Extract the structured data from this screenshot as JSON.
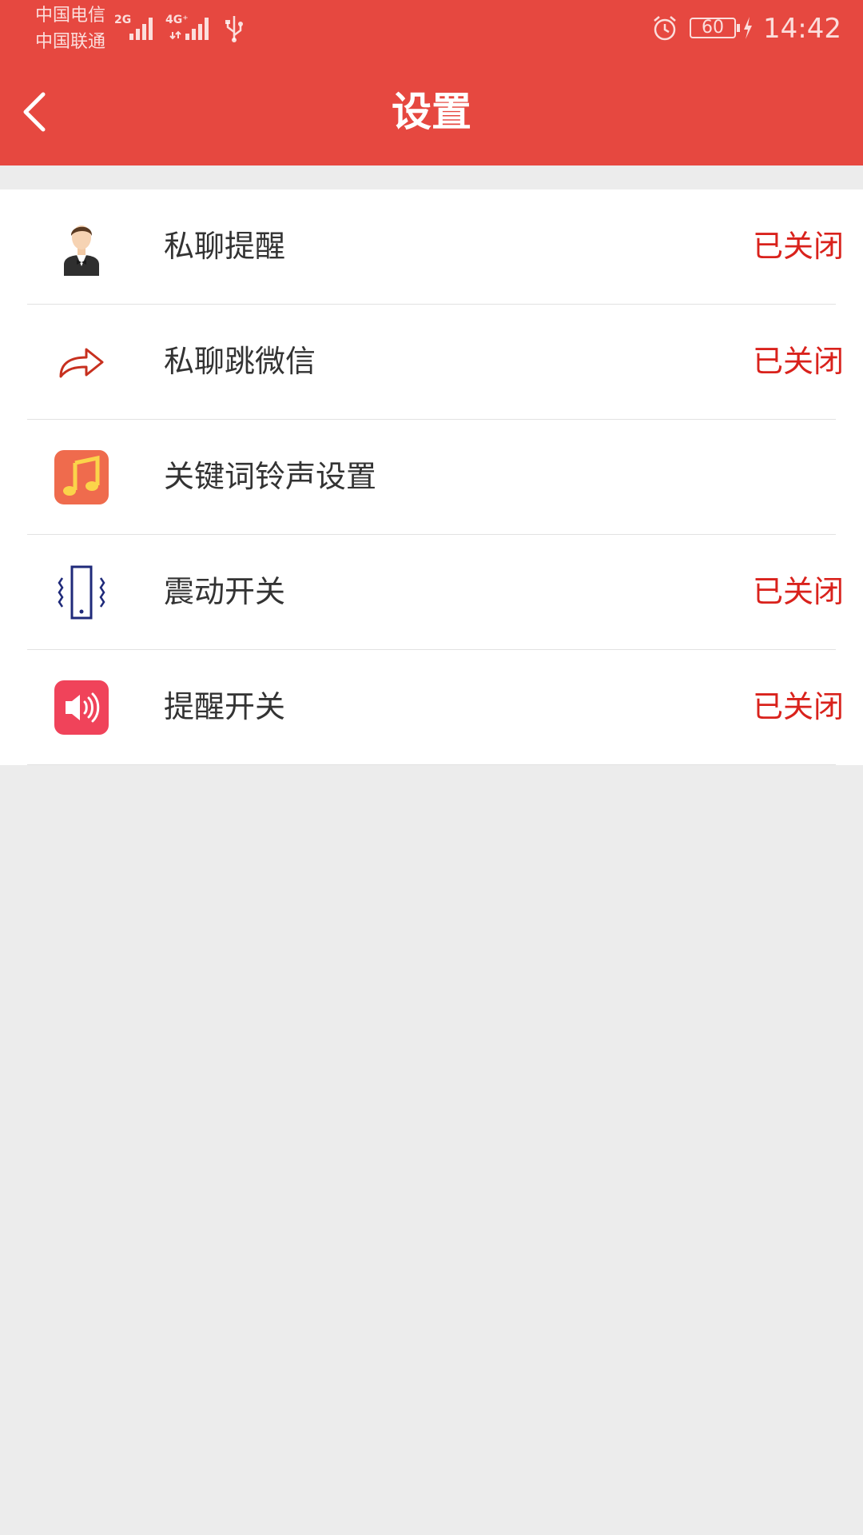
{
  "status_bar": {
    "carrier_1": "中国电信",
    "carrier_2": "中国联通",
    "sim1_network": "2G",
    "sim2_network": "4G⁺",
    "battery": "60",
    "time": "14:42"
  },
  "header": {
    "title": "设置",
    "back_icon": "chevron-left-icon"
  },
  "settings": [
    {
      "icon": "waiter-avatar-icon",
      "label": "私聊提醒",
      "status": "已关闭"
    },
    {
      "icon": "share-arrow-icon",
      "label": "私聊跳微信",
      "status": "已关闭"
    },
    {
      "icon": "music-note-icon",
      "label": "关键词铃声设置",
      "status": ""
    },
    {
      "icon": "vibrate-phone-icon",
      "label": "震动开关",
      "status": "已关闭"
    },
    {
      "icon": "speaker-icon",
      "label": "提醒开关",
      "status": "已关闭"
    }
  ],
  "colors": {
    "header_bg": "#e64840",
    "status_off": "#d9221c",
    "page_bg": "#ececec"
  }
}
